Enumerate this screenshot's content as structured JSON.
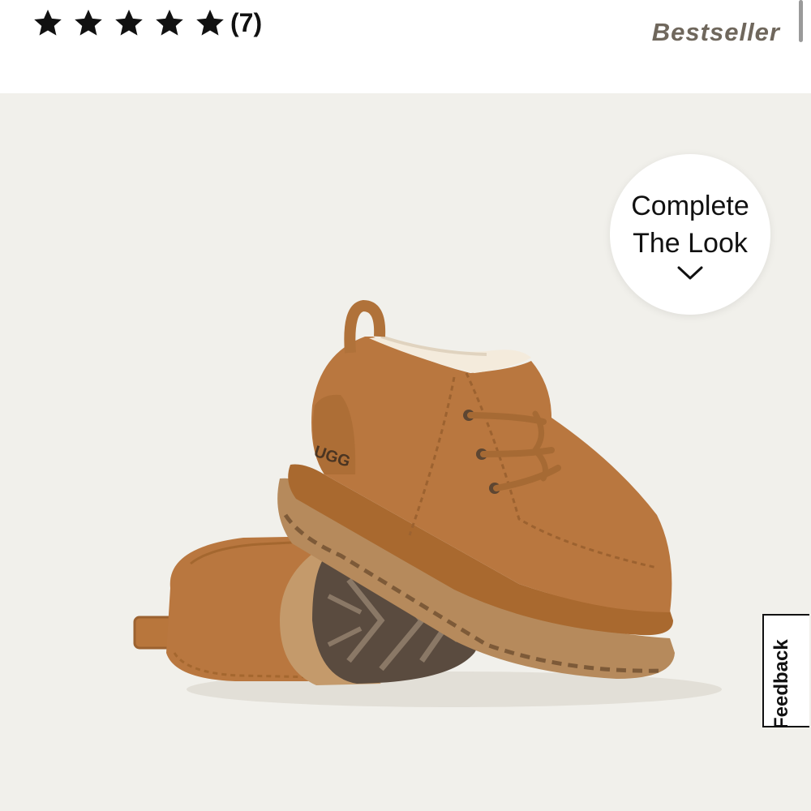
{
  "product": {
    "rating": {
      "stars": 5,
      "max_stars": 5,
      "review_count": "(7)"
    },
    "badge": "Bestseller",
    "image": {
      "icon": "product-boot-image",
      "brand_mark": "UGG"
    }
  },
  "complete_look": {
    "line1": "Complete",
    "line2": "The Look",
    "icon": "chevron-down-icon"
  },
  "feedback": {
    "label": "Feedback"
  },
  "colors": {
    "star": "#111111",
    "badge": "#6f675c",
    "background": "#f1f0eb",
    "suede": "#b9773f",
    "sole": "#b68a5c"
  }
}
